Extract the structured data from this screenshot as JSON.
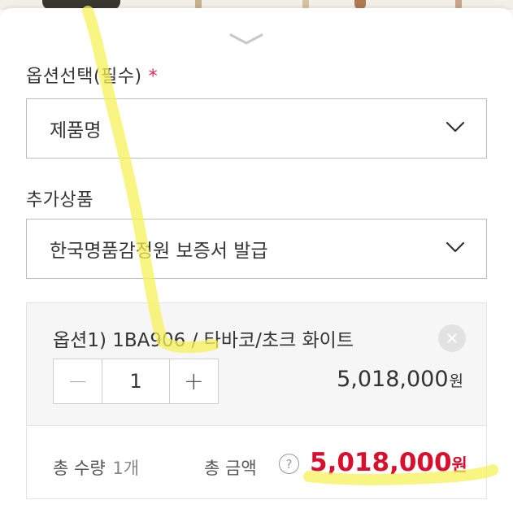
{
  "option_select": {
    "label": "옵션선택(필수)",
    "required_mark": "*",
    "selected_value": "제품명"
  },
  "addon": {
    "label": "추가상품",
    "selected_value": "한국명품감정원 보증서 발급"
  },
  "selected_option": {
    "title": "옵션1) 1BA906 / 타바코/초크 화이트",
    "decrement": "−",
    "quantity": "1",
    "increment": "+",
    "price": "5,018,000",
    "price_unit": "원"
  },
  "summary": {
    "qty_label": "총 수량",
    "qty_value": "1개",
    "amount_label": "총 금액",
    "help_symbol": "?",
    "total": "5,018,000",
    "total_unit": "원"
  },
  "colors": {
    "accent_red": "#d7102d",
    "required_star": "#e0294b",
    "highlighter": "#f5f25a"
  },
  "icons": [
    "handle-chevron-icon",
    "chevron-down-icon",
    "close-icon",
    "help-icon"
  ]
}
